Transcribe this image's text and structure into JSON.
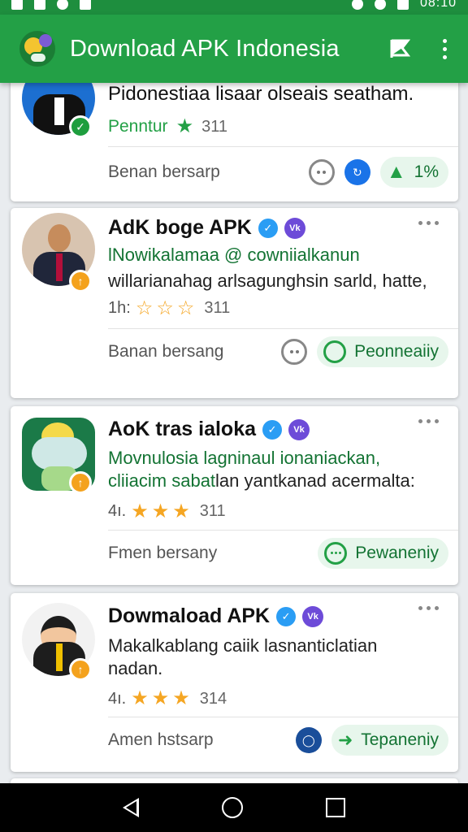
{
  "status_bar": {
    "time": "08:10"
  },
  "app_bar": {
    "title": "Download APK Indonesia"
  },
  "cards": [
    {
      "title": "Pidonestiaa lisaar olseais seatham.",
      "rating_prefix": "Penntur",
      "rating_count": "311",
      "bottom_label": "Benan bersarp",
      "like_count": "1%"
    },
    {
      "title": "AdK boge APK",
      "subtitle": "lNowikalamaa @ cowniialkanun",
      "description": "willarianahag arlsagunghsin sarld, hatte,",
      "rating_prefix": "1h:",
      "rating_count": "311",
      "bottom_label": "Banan bersang",
      "action_label": "Peonneaiiy"
    },
    {
      "title": "AoK tras ialoka",
      "subtitle_green": "Movnulosia lagninaul ionaniackan,",
      "subtitle_green2": "cliiacim sabat",
      "subtitle_rest": "lan yantkanad acermalta:",
      "rating_prefix": "4ı.",
      "rating_count": "311",
      "bottom_label": "Fmen bersany",
      "action_label": "Pewaneniy"
    },
    {
      "title": "Dowmaload APK",
      "description": "Makalkablang caiik lasnanticlatian nadan.",
      "rating_prefix": "4ı.",
      "rating_count": "314",
      "bottom_label": "Amen hstsarp",
      "action_label": "Tepaneniy"
    }
  ],
  "icons": {
    "verified": "check-icon",
    "blue_badge": "blue-check-badge-icon",
    "purple_badge": "vk-badge-icon",
    "purple_badge_text": "Vk"
  },
  "colors": {
    "app_bar": "#23a046",
    "accent_green": "#137333",
    "star": "#f5a623"
  }
}
